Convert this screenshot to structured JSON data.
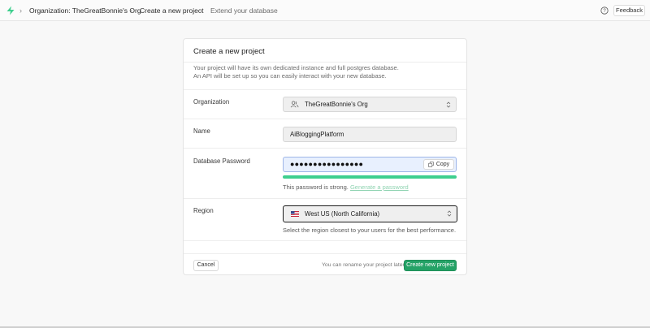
{
  "breadcrumb": {
    "organization": "Organization: TheGreatBonnie's Org",
    "create_project": "Create a new project",
    "extend_database": "Extend your database"
  },
  "header": {
    "feedback_label": "Feedback"
  },
  "form": {
    "title": "Create a new project",
    "description_line1": "Your project will have its own dedicated instance and full postgres database.",
    "description_line2": "An API will be set up so you can easily interact with your new database.",
    "organization": {
      "label": "Organization",
      "value": "TheGreatBonnie's Org"
    },
    "name": {
      "label": "Name",
      "value": "AiBloggingPlatform"
    },
    "password": {
      "label": "Database Password",
      "value": "●●●●●●●●●●●●●●●●",
      "copy_label": "Copy",
      "strength_fraction": 1.0,
      "hint_text": "This password is strong.",
      "generate_link": "Generate a password"
    },
    "region": {
      "label": "Region",
      "value": "West US (North California)",
      "hint_text": "Select the region closest to your users for the best performance."
    },
    "footer": {
      "cancel_label": "Cancel",
      "note": "You can rename your project later",
      "create_label": "Create new project"
    }
  },
  "colors": {
    "brand_green": "#3ecf8e",
    "button_green": "#24a266"
  }
}
